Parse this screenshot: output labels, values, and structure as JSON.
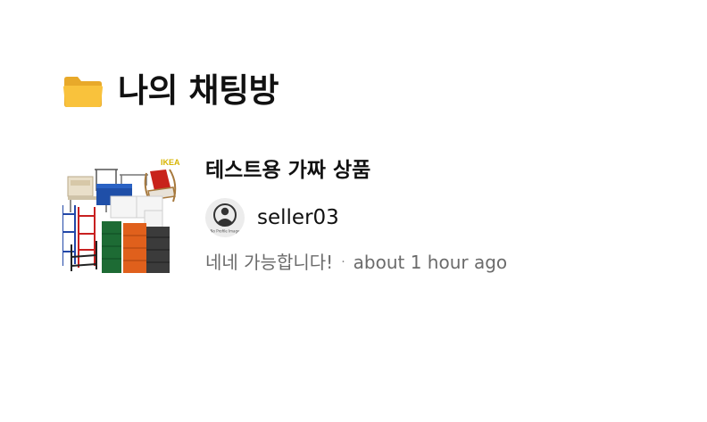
{
  "header": {
    "title": "나의 채팅방",
    "icon": "folder-icon",
    "icon_color": "#f9c23c"
  },
  "chats": [
    {
      "product_title": "테스트용 가짜 상품",
      "thumbnail_brand_text": "IKEA",
      "seller": {
        "name": "seller03",
        "avatar_caption": "No Profile Image"
      },
      "last_message": "네네 가능합니다!",
      "separator": "·",
      "time": "about 1 hour ago"
    }
  ]
}
